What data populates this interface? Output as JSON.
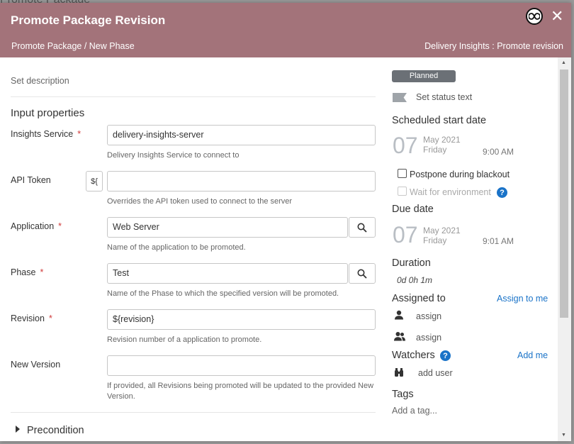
{
  "backdrop": {
    "title": "Promote Package"
  },
  "header": {
    "title": "Promote Package Revision",
    "breadcrumb": "Promote Package / New Phase",
    "context": "Delivery Insights : Promote revision"
  },
  "left": {
    "description_placeholder": "Set description",
    "section_title": "Input properties",
    "fields": {
      "insights_service": {
        "label": "Insights Service",
        "required": "*",
        "value": "delivery-insights-server",
        "help": "Delivery Insights Service to connect to"
      },
      "api_token": {
        "label": "API Token",
        "var_button": "${",
        "value": "",
        "help": "Overrides the API token used to connect to the server"
      },
      "application": {
        "label": "Application",
        "required": "*",
        "value": "Web Server",
        "help": "Name of the application to be promoted."
      },
      "phase": {
        "label": "Phase",
        "required": "*",
        "value": "Test",
        "help": "Name of the Phase to which the specified version will be promoted."
      },
      "revision": {
        "label": "Revision",
        "required": "*",
        "value": "${revision}",
        "help": "Revision number of a application to promote."
      },
      "new_version": {
        "label": "New Version",
        "value": "",
        "help": "If provided, all Revisions being promoted will be updated to the provided New Version."
      }
    },
    "precondition": "Precondition"
  },
  "right": {
    "status_badge": "Planned",
    "status_text": "Set status text",
    "scheduled_start": {
      "heading": "Scheduled start date",
      "day": "07",
      "month_year": "May 2021",
      "weekday": "Friday",
      "time": "9:00 AM"
    },
    "postpone_label": "Postpone during blackout",
    "wait_label": "Wait for environment",
    "due": {
      "heading": "Due date",
      "day": "07",
      "month_year": "May 2021",
      "weekday": "Friday",
      "time": "9:01 AM"
    },
    "duration": {
      "heading": "Duration",
      "value": "0d 0h 1m"
    },
    "assigned": {
      "heading": "Assigned to",
      "link": "Assign to me",
      "user": "assign",
      "team": "assign"
    },
    "watchers": {
      "heading": "Watchers",
      "link": "Add me",
      "add": "add user"
    },
    "tags": {
      "heading": "Tags",
      "placeholder": "Add a tag..."
    }
  },
  "colors": {
    "header": "#a3737a",
    "link": "#1a73c8",
    "required": "#d03a3a",
    "badge": "#6b7076"
  }
}
